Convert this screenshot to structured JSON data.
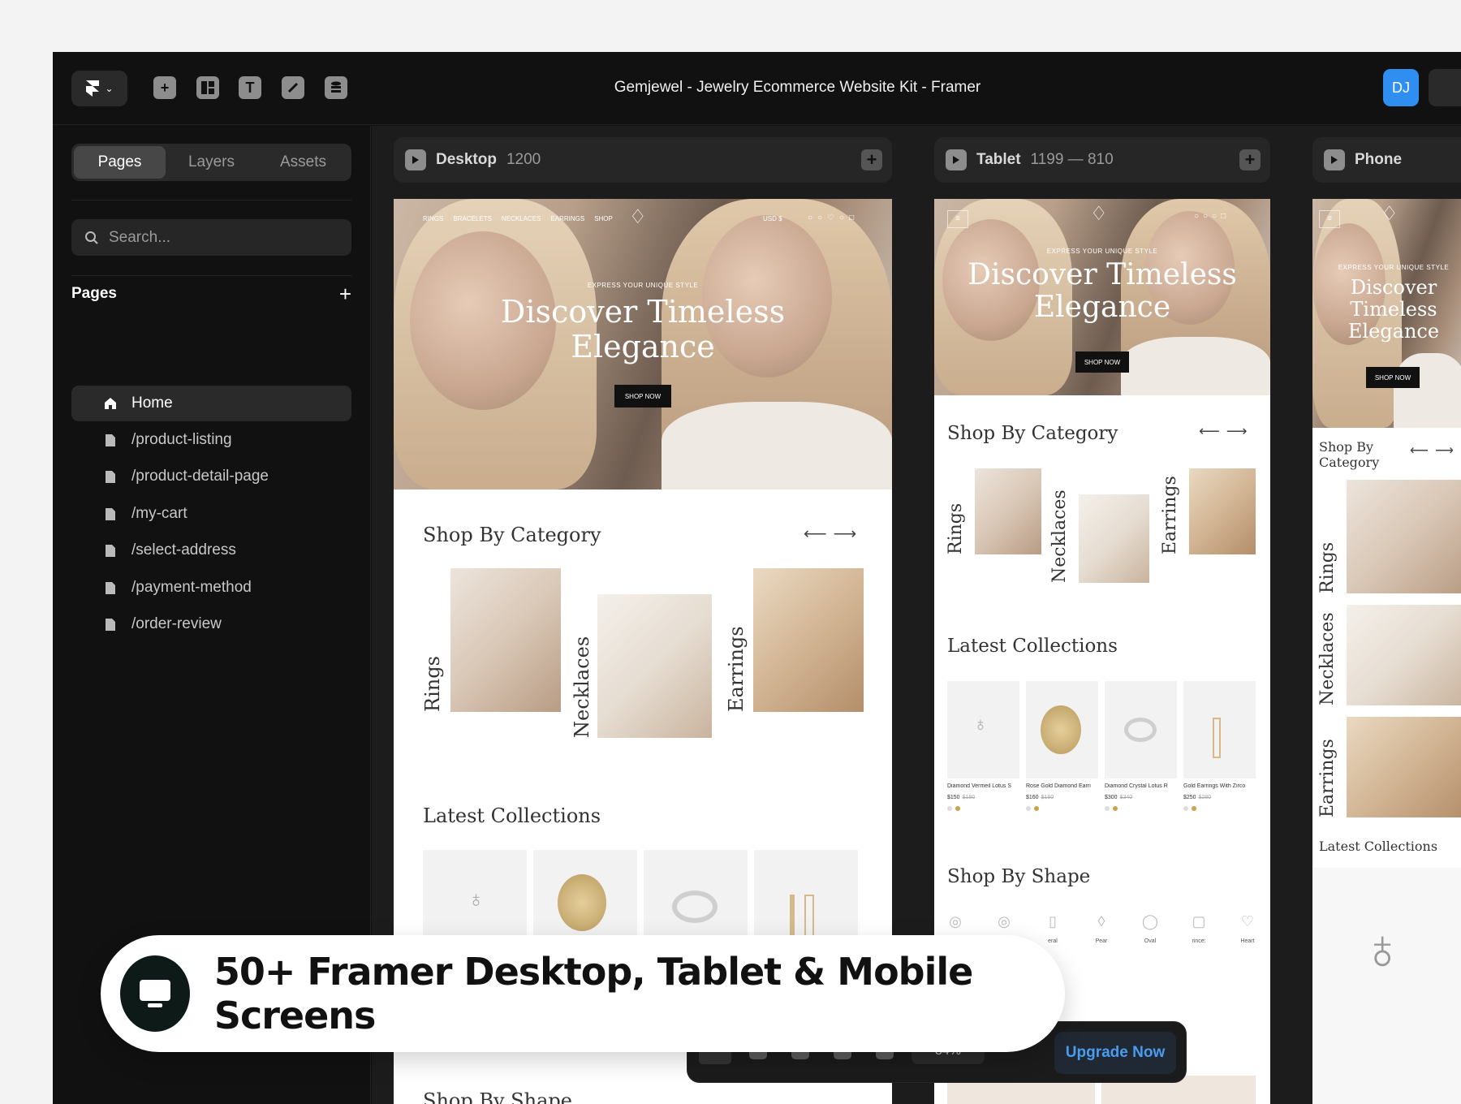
{
  "window": {
    "title": "Gemjewel - Jewelry Ecommerce Website Kit - Framer",
    "avatar_initials": "DJ"
  },
  "toolbar_icons": [
    "plus-icon",
    "layout-icon",
    "text-icon",
    "link-icon",
    "database-icon"
  ],
  "sidebar": {
    "tabs": [
      "Pages",
      "Layers",
      "Assets"
    ],
    "active_tab": "Pages",
    "search_placeholder": "Search...",
    "section_title": "Pages",
    "pages": [
      {
        "label": "Home",
        "icon": "home-icon",
        "active": true
      },
      {
        "label": "/product-listing",
        "icon": "page-icon"
      },
      {
        "label": "/product-detail-page",
        "icon": "page-icon"
      },
      {
        "label": "/my-cart",
        "icon": "page-icon"
      },
      {
        "label": "/select-address",
        "icon": "page-icon"
      },
      {
        "label": "/payment-method",
        "icon": "page-icon"
      },
      {
        "label": "/order-review",
        "icon": "page-icon"
      }
    ]
  },
  "breakpoints": [
    {
      "name": "Desktop",
      "size": "1200"
    },
    {
      "name": "Tablet",
      "size": "1199 — 810"
    },
    {
      "name": "Phone",
      "size": ""
    }
  ],
  "site": {
    "nav": [
      "RINGS",
      "BRACELETS",
      "NECKLACES",
      "EARRINGS",
      "SHOP"
    ],
    "currency": "USD $",
    "hero_eyebrow": "EXPRESS YOUR UNIQUE STYLE",
    "hero_title_1": "Discover Timeless",
    "hero_title_2": "Elegance",
    "hero_title_phone_1": "Discover",
    "hero_title_phone_2": "Timeless",
    "hero_title_phone_3": "Elegance",
    "shop_button": "SHOP NOW",
    "shop_by_category": "Shop By Category",
    "phone_shop_by_1": "Shop By",
    "phone_shop_by_2": "Category",
    "categories": [
      "Rings",
      "Necklaces",
      "Earrings"
    ],
    "latest_collections": "Latest Collections",
    "shop_by_shape": "Shop By Shape",
    "products": [
      {
        "name": "Diamond Vermeil Lotus S",
        "price": "$150",
        "old": "$180"
      },
      {
        "name": "Rose Gold Diamond Earri",
        "price": "$160",
        "old": "$180"
      },
      {
        "name": "Diamond Crystal Lotus R",
        "price": "$300",
        "old": "$340"
      },
      {
        "name": "Gold Earrings With Zirco",
        "price": "$250",
        "old": "$280"
      }
    ],
    "shapes": [
      "",
      "",
      "eral",
      "Pear",
      "Oval",
      "rince:",
      "Heart"
    ]
  },
  "banner": {
    "text": "50+ Framer Desktop, Tablet & Mobile Screens",
    "icon": "monitor-icon"
  },
  "bottom_toolbar": {
    "zoom": "84%",
    "upgrade_label": "Upgrade Now"
  },
  "colors": {
    "accent": "#2f8ff0",
    "app_bg": "#111111",
    "upgrade_text": "#4a9cf0",
    "gold": "#c9a449"
  }
}
